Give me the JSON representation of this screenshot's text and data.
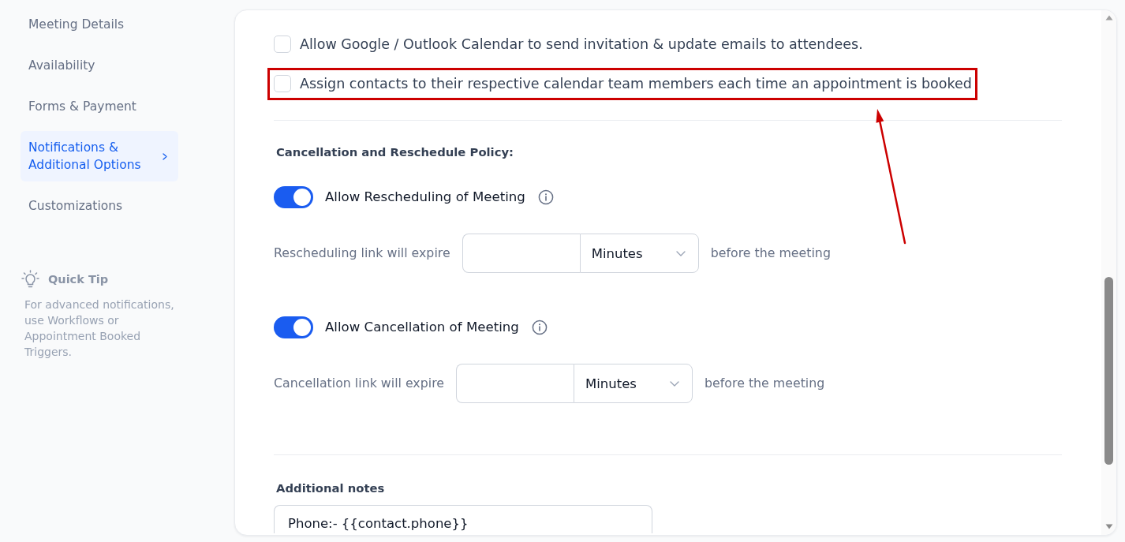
{
  "sidebar": {
    "items": [
      {
        "label": "Meeting Details",
        "selected": false
      },
      {
        "label": "Availability",
        "selected": false
      },
      {
        "label": "Forms & Payment",
        "selected": false
      },
      {
        "label": "Notifications & Additional Options",
        "selected": true
      },
      {
        "label": "Customizations",
        "selected": false
      }
    ],
    "quick_tip": {
      "title": "Quick Tip",
      "text": "For advanced notifications, use Workflows or Appointment Booked Triggers."
    }
  },
  "options": [
    {
      "label": "Allow Google / Outlook Calendar to send invitation & update emails to attendees.",
      "checked": false,
      "highlighted": false
    },
    {
      "label": "Assign contacts to their respective calendar team members each time an appointment is booked",
      "checked": false,
      "highlighted": true
    }
  ],
  "policy": {
    "title": "Cancellation and Reschedule Policy:",
    "rules": [
      {
        "label": "Allow Rescheduling of Meeting",
        "on": true,
        "expiry_label": "Rescheduling link will expire",
        "unit": "Minutes",
        "suffix": "before the meeting"
      },
      {
        "label": "Allow Cancellation of Meeting",
        "on": true,
        "expiry_label": "Cancellation link will expire",
        "unit": "Minutes",
        "suffix": "before the meeting"
      }
    ]
  },
  "notes": {
    "title": "Additional notes",
    "value": "Phone:- {{contact.phone}}"
  }
}
